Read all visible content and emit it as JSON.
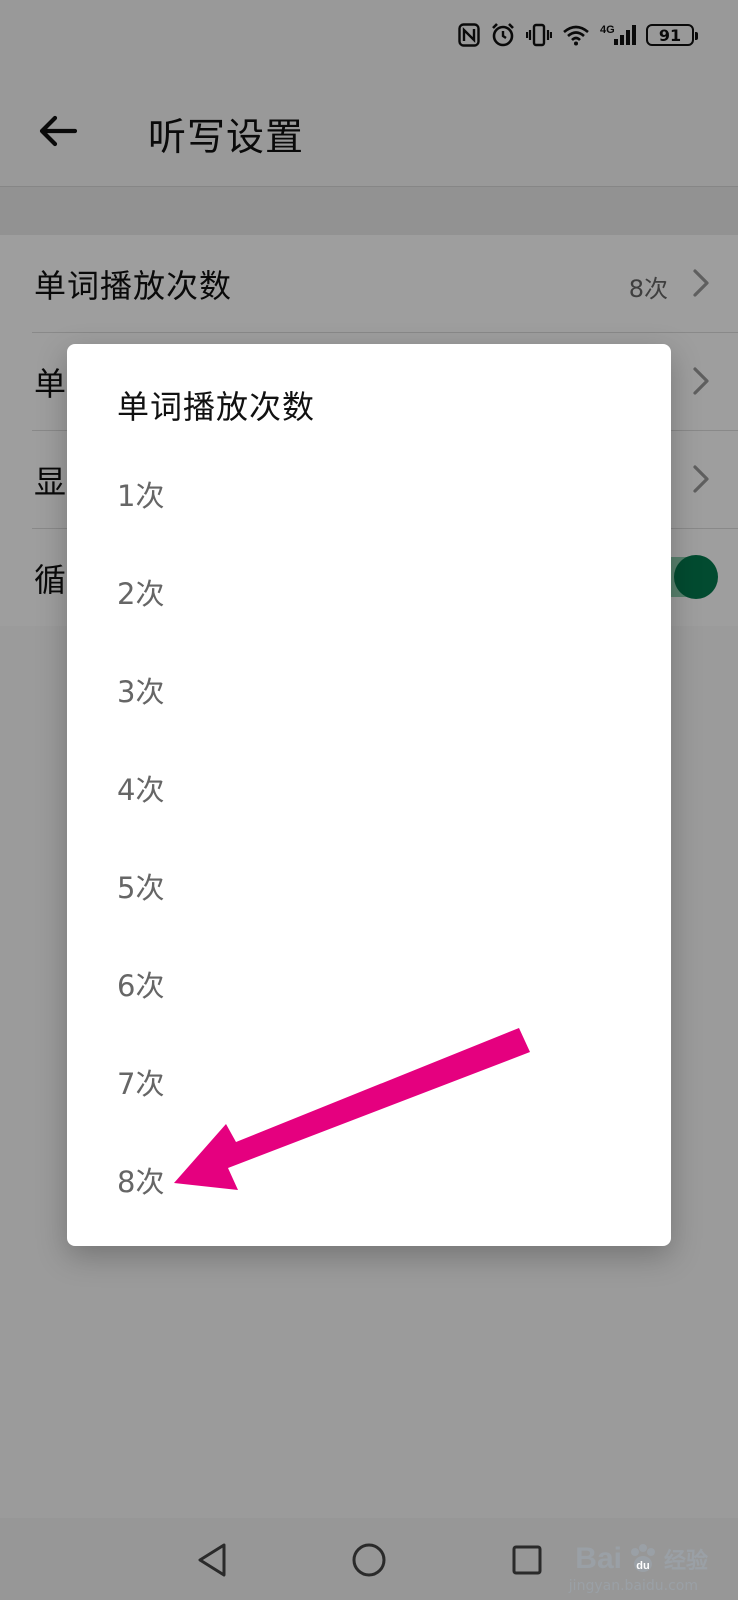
{
  "status_bar": {
    "battery_level": "91",
    "network": "4G",
    "icons": [
      "nfc-icon",
      "alarm-icon",
      "vibrate-icon",
      "wifi-icon",
      "signal-icon",
      "battery-icon"
    ]
  },
  "app_bar": {
    "title": "听写设置",
    "back_icon": "arrow-left-icon"
  },
  "settings": {
    "items": [
      {
        "label": "单词播放次数",
        "value": "8次",
        "control": "chevron"
      },
      {
        "label": "单",
        "value": "",
        "control": "chevron"
      },
      {
        "label": "显",
        "value": "",
        "control": "chevron"
      },
      {
        "label": "循",
        "value": "",
        "control": "toggle",
        "toggle_on": true
      }
    ]
  },
  "dialog": {
    "title": "单词播放次数",
    "options": [
      "1次",
      "2次",
      "3次",
      "4次",
      "5次",
      "6次",
      "7次",
      "8次"
    ],
    "selected": "8次"
  },
  "nav_bar": {
    "icons": [
      "back-triangle-icon",
      "home-circle-icon",
      "recents-square-icon"
    ]
  },
  "watermark": {
    "brand": "Bai",
    "brand_suffix": "du",
    "cn": "经验",
    "url": "jingyan.baidu.com"
  },
  "colors": {
    "accent_green": "#047a4e",
    "annotation_arrow": "#e5007f",
    "dim_overlay": "rgba(0,0,0,0.38)"
  }
}
